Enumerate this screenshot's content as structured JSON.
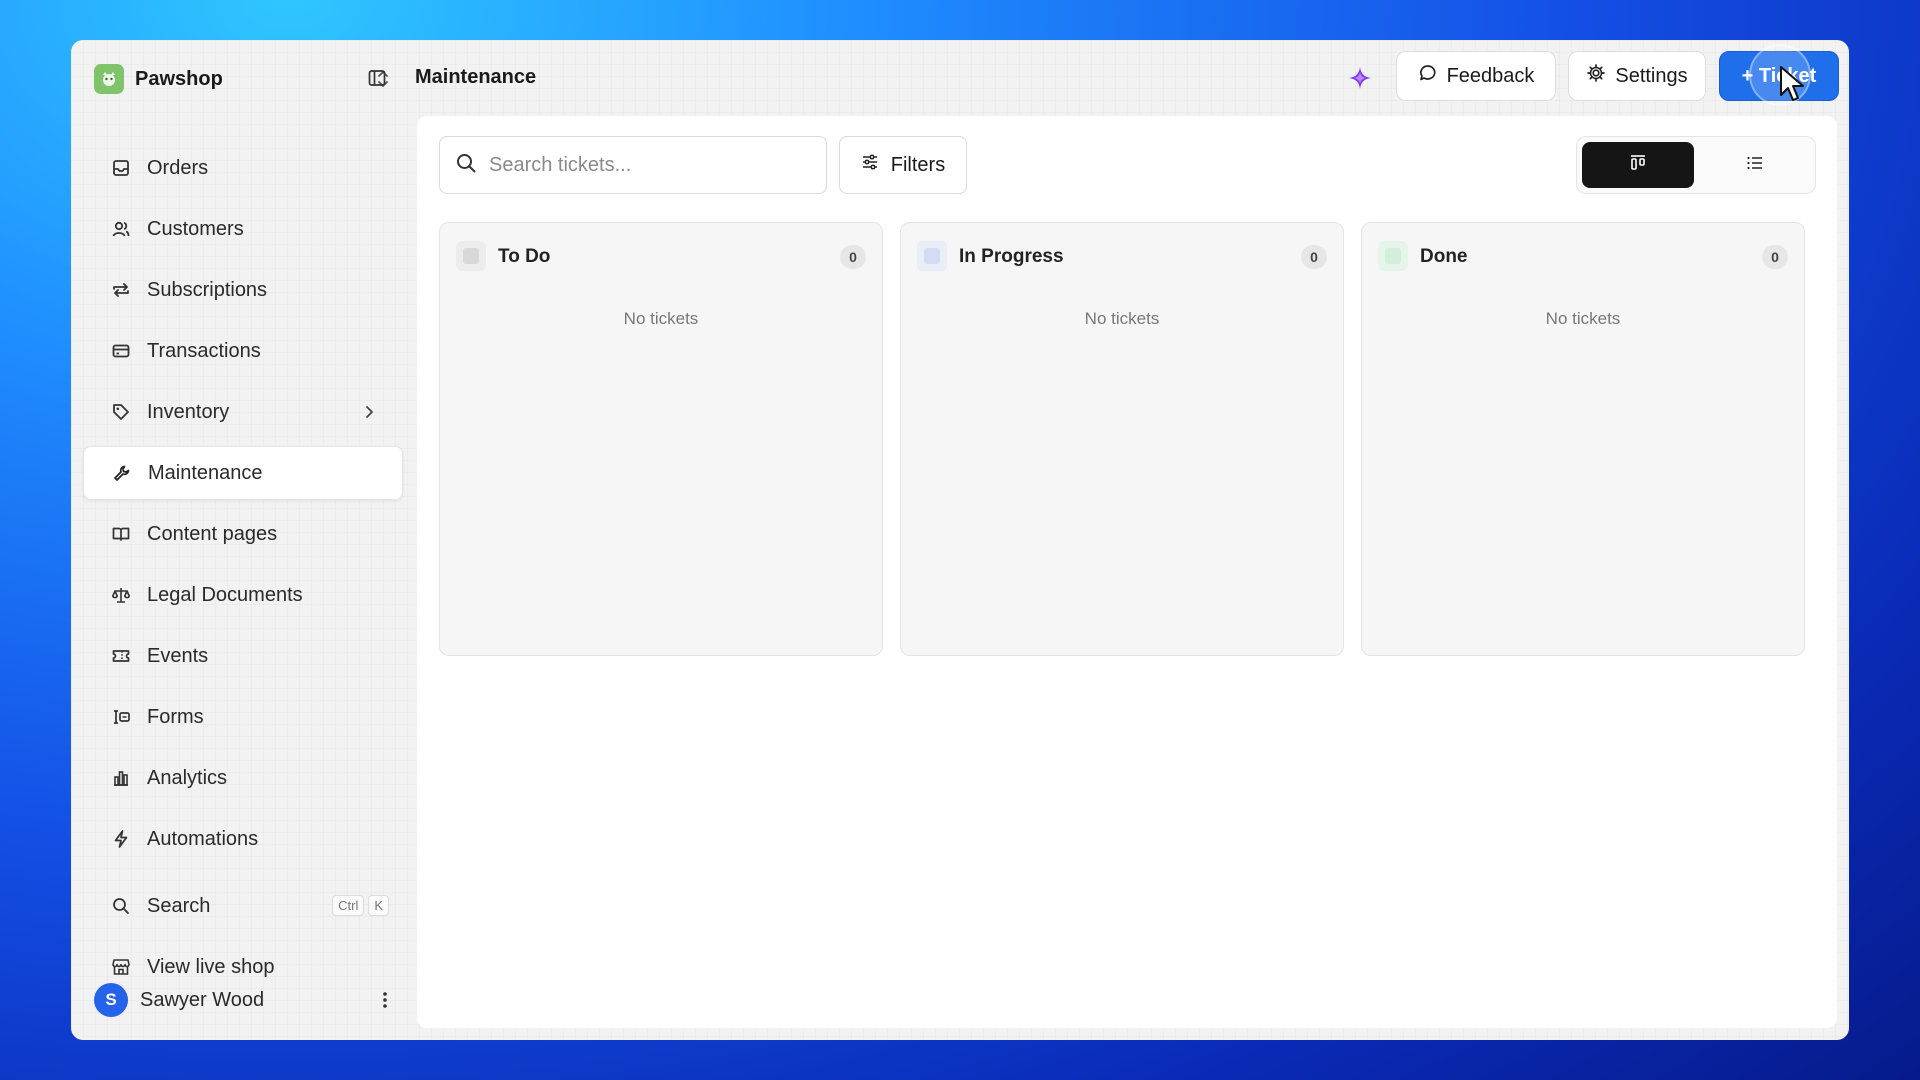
{
  "brand": {
    "name": "Pawshop"
  },
  "header": {
    "title": "Maintenance",
    "feedback_label": "Feedback",
    "settings_label": "Settings",
    "ticket_label": "+ Ticket"
  },
  "sidebar": {
    "items": [
      {
        "label": "Orders",
        "icon": "inbox-icon"
      },
      {
        "label": "Customers",
        "icon": "users-icon"
      },
      {
        "label": "Subscriptions",
        "icon": "repeat-icon"
      },
      {
        "label": "Transactions",
        "icon": "credit-card-icon"
      },
      {
        "label": "Inventory",
        "icon": "tag-icon"
      },
      {
        "label": "Maintenance",
        "icon": "wrench-icon",
        "active": true
      },
      {
        "label": "Content pages",
        "icon": "book-icon"
      },
      {
        "label": "Legal Documents",
        "icon": "scale-icon"
      },
      {
        "label": "Events",
        "icon": "ticket-icon"
      },
      {
        "label": "Forms",
        "icon": "form-icon"
      },
      {
        "label": "Analytics",
        "icon": "bar-chart-icon"
      },
      {
        "label": "Automations",
        "icon": "bolt-icon"
      }
    ],
    "search": {
      "label": "Search",
      "shortcut_ctrl": "Ctrl",
      "shortcut_key": "K"
    },
    "live_shop_label": "View live shop",
    "user": {
      "name": "Sawyer Wood",
      "initial": "S"
    }
  },
  "toolbar": {
    "search_placeholder": "Search tickets...",
    "filters_label": "Filters"
  },
  "board": {
    "columns": [
      {
        "title": "To Do",
        "count": "0",
        "empty_text": "No tickets",
        "color": "#d8d8d8"
      },
      {
        "title": "In Progress",
        "count": "0",
        "empty_text": "No tickets",
        "color": "#d3dcf3"
      },
      {
        "title": "Done",
        "count": "0",
        "empty_text": "No tickets",
        "color": "#d3efdc"
      }
    ]
  },
  "colors": {
    "accent": "#1f6feb",
    "sparkle": "#7c3aed"
  }
}
